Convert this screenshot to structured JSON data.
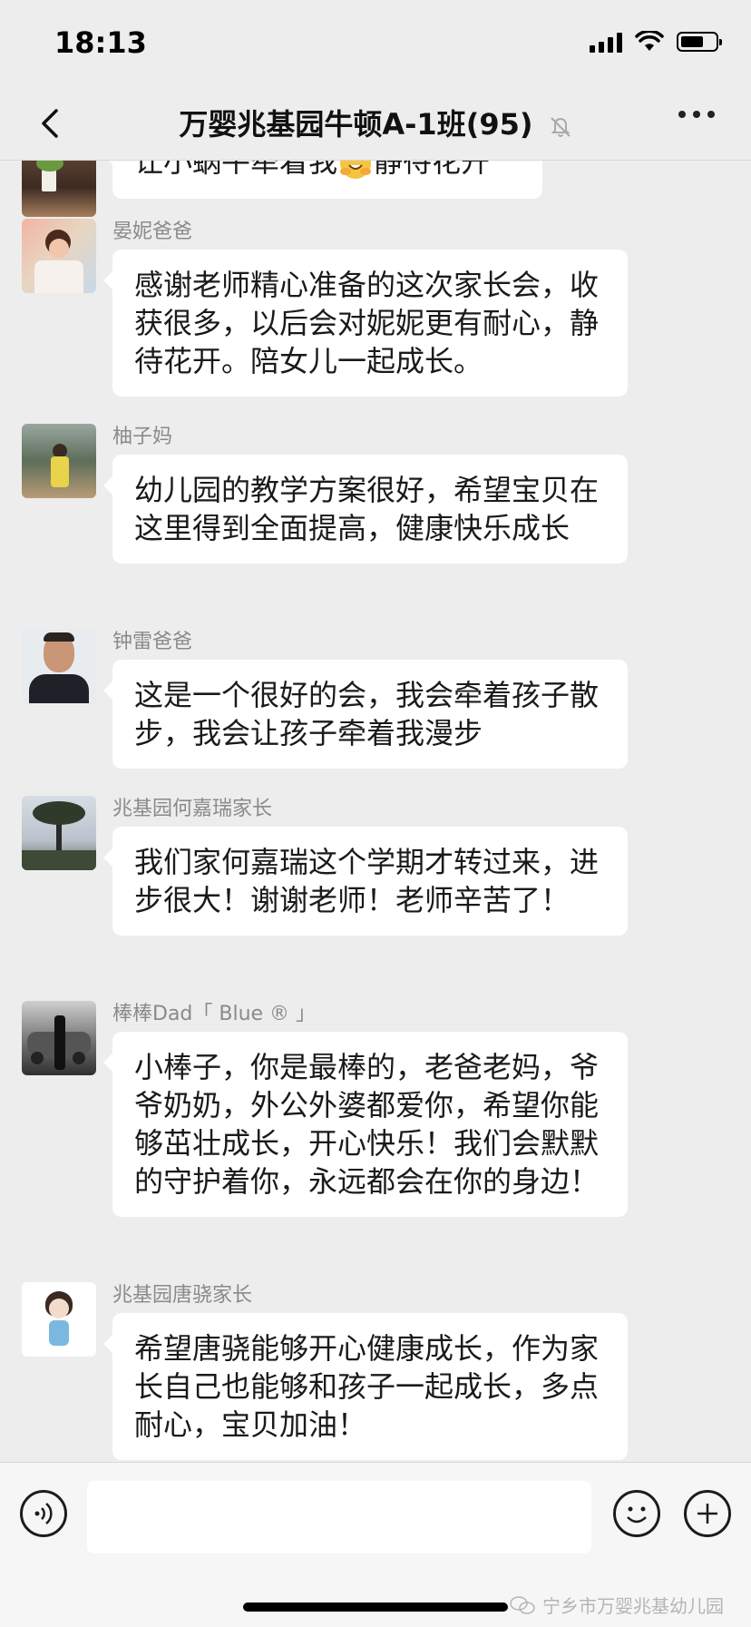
{
  "status": {
    "time": "18:13"
  },
  "nav": {
    "title": "万婴兆基园牛顿A-1班(95)"
  },
  "messages": [
    {
      "sender": "",
      "text_before": "让小蜗牛牵着我",
      "emoji": "hugging-face",
      "text_after": "静待花开"
    },
    {
      "sender": "晏妮爸爸",
      "text": "感谢老师精心准备的这次家长会，收获很多，以后会对妮妮更有耐心，静待花开。陪女儿一起成长。"
    },
    {
      "sender": "柚子妈",
      "text": "幼儿园的教学方案很好，希望宝贝在这里得到全面提高，健康快乐成长"
    },
    {
      "sender": "钟雷爸爸",
      "text": "这是一个很好的会，我会牵着孩子散步，我会让孩子牵着我漫步"
    },
    {
      "sender": "兆基园何嘉瑞家长",
      "text": "我们家何嘉瑞这个学期才转过来，进步很大！谢谢老师！老师辛苦了！"
    },
    {
      "sender": "棒棒Dad「 Blue ® 」",
      "text": "小棒子，你是最棒的，老爸老妈，爷爷奶奶，外公外婆都爱你，希望你能够茁壮成长，开心快乐！我们会默默的守护着你，永远都会在你的身边！"
    },
    {
      "sender": "兆基园唐骁家长",
      "text": "希望唐骁能够开心健康成长，作为家长自己也能够和孩子一起成长，多点耐心，宝贝加油！"
    }
  ],
  "watermark": "宁乡市万婴兆基幼儿园",
  "icons": {
    "back": "chevron-left-icon",
    "mute": "bell-slash-icon",
    "more": "more-dots-icon",
    "voice": "voice-icon",
    "emoji": "smile-icon",
    "plus": "plus-icon"
  }
}
